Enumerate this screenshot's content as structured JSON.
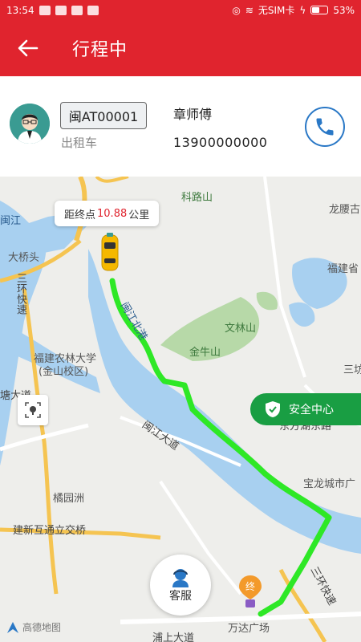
{
  "status_bar": {
    "time": "13:54",
    "carrier": "无SIM卡",
    "battery": "53%",
    "battery_level": 0.53
  },
  "app_bar": {
    "title": "行程中",
    "back_icon": "arrow-left-icon"
  },
  "driver": {
    "plate": "闽AT00001",
    "vehicle_type": "出租车",
    "name": "章师傅",
    "phone": "13900000000",
    "call_icon": "phone-icon"
  },
  "map": {
    "distance_prefix": "距终点",
    "distance_value": "10.88",
    "distance_unit": "公里",
    "safety_label": "安全中心",
    "service_label": "客服",
    "end_label": "终",
    "provider": "高德地图",
    "labels": {
      "kelushan": "科路山",
      "longtengda": "龙腰古",
      "mingjiang_short": "闽江",
      "dajiaotou": "大桥头",
      "sanhuan1": "三环快速",
      "fujian_sheng": "福建省",
      "minjiang_north": "闽江北港",
      "wenlinshan": "文林山",
      "jinniushan": "金牛山",
      "nonglin": "福建农林大学",
      "jinshan": "(金山校区)",
      "sanfang": "三坊",
      "tangdao": "塘大道",
      "dongfang": "东方湖东路",
      "minjiang_avenue": "闽江大道",
      "baolong": "宝龙城市广",
      "juyuanzhou": "橘园洲",
      "jianxin": "建新互通立交桥",
      "wanda": "万达广场",
      "pushang": "浦上大道",
      "sanhuan2": "三环快速"
    }
  },
  "colors": {
    "brand": "#e0242e",
    "route": "#2ee826",
    "safety": "#199e43",
    "phone_blue": "#2a78c6"
  }
}
